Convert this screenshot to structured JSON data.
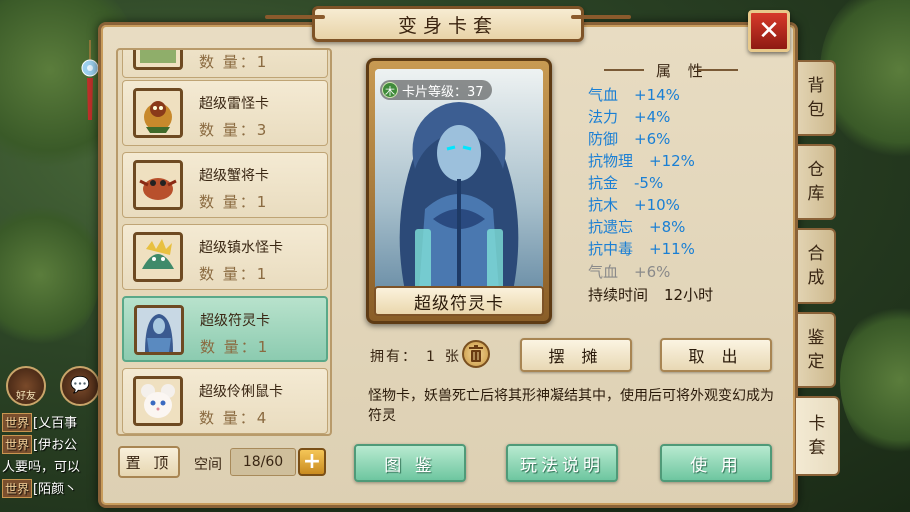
{
  "window": {
    "title": "变身卡套",
    "close_label": "✕"
  },
  "list": {
    "items": [
      {
        "name": "",
        "count_label": "数 量：",
        "count": "1",
        "icon": "card-top-icon",
        "partial": true
      },
      {
        "name": "超级雷怪卡",
        "count_label": "数 量：",
        "count": "3",
        "icon": "thunder-monster-icon"
      },
      {
        "name": "超级蟹将卡",
        "count_label": "数 量：",
        "count": "1",
        "icon": "crab-general-icon"
      },
      {
        "name": "超级镇水怪卡",
        "count_label": "数 量：",
        "count": "1",
        "icon": "water-monster-icon"
      },
      {
        "name": "超级符灵卡",
        "count_label": "数 量：",
        "count": "1",
        "icon": "talisman-spirit-icon",
        "selected": true
      },
      {
        "name": "超级伶俐鼠卡",
        "count_label": "数 量：",
        "count": "4",
        "icon": "clever-mouse-icon"
      }
    ],
    "pin_label": "置 顶",
    "space_label": "空间",
    "space_value": "18/60",
    "plus_label": "+"
  },
  "card": {
    "level_text": "卡片等级：37",
    "element_badge": "木",
    "name": "超级符灵卡"
  },
  "attributes": {
    "title": "属 性",
    "rows": [
      {
        "name": "气血",
        "value": "+14%",
        "style": "blue"
      },
      {
        "name": "法力",
        "value": "+4%",
        "style": "blue"
      },
      {
        "name": "防御",
        "value": "+6%",
        "style": "blue"
      },
      {
        "name": "抗物理",
        "value": "+12%",
        "style": "blue"
      },
      {
        "name": "抗金",
        "value": "-5%",
        "style": "blue"
      },
      {
        "name": "抗木",
        "value": "+10%",
        "style": "blue"
      },
      {
        "name": "抗遗忘",
        "value": "+8%",
        "style": "blue"
      },
      {
        "name": "抗中毒",
        "value": "+11%",
        "style": "blue"
      },
      {
        "name": "气血",
        "value": "+6%",
        "style": "gray"
      },
      {
        "name": "持续时间",
        "value": "12小时",
        "style": "dark"
      }
    ]
  },
  "owned": {
    "label": "拥有：",
    "count": "1",
    "unit": "张"
  },
  "buttons": {
    "stall": "摆 摊",
    "cancel": "取 出",
    "codex": "图 鉴",
    "howto": "玩法说明",
    "use": "使 用"
  },
  "description": "怪物卡，妖兽死亡后将其形神凝结其中，使用后可将外观变幻成为符灵",
  "tabs": [
    {
      "label": "背包"
    },
    {
      "label": "仓库"
    },
    {
      "label": "合成"
    },
    {
      "label": "鉴定"
    },
    {
      "label": "卡套"
    }
  ],
  "chat": {
    "friends_label": "好友",
    "lines": [
      {
        "tag": "世界",
        "text": "[乂百事"
      },
      {
        "tag": "世界",
        "text": "[伊お公"
      },
      {
        "tag": "",
        "text": "人要吗，可以"
      },
      {
        "tag": "世界",
        "text": "[陌颜丶"
      }
    ]
  },
  "colors": {
    "accent_blue": "#1a7fd4",
    "selected_green": "#8ccbb0",
    "button_green": "#6ec6a0",
    "close_red": "#d63a2a"
  }
}
